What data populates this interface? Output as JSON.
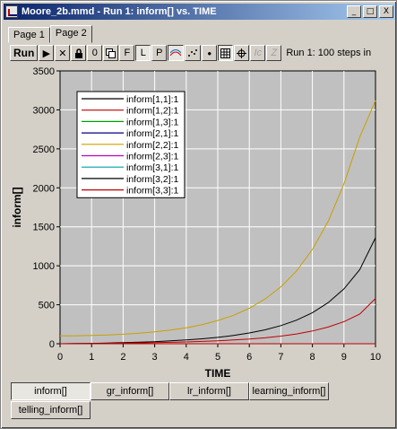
{
  "window": {
    "title": "Moore_2b.mmd - Run 1: inform[] vs. TIME",
    "minimize": "_",
    "maximize": "□",
    "close": "X"
  },
  "page_tabs": [
    "Page 1",
    "Page 2"
  ],
  "active_page_tab": 1,
  "toolbar": {
    "run_label": "Run",
    "buttons": [
      {
        "id": "play",
        "label": "▶"
      },
      {
        "id": "stop",
        "label": "✕"
      },
      {
        "id": "lock",
        "label": "🔒"
      },
      {
        "id": "zero",
        "label": "0"
      },
      {
        "id": "copy",
        "label": "⧉"
      },
      {
        "id": "f",
        "label": "F"
      },
      {
        "id": "l",
        "label": "L"
      },
      {
        "id": "p",
        "label": "P"
      },
      {
        "id": "wave",
        "label": "≈"
      },
      {
        "id": "scatter",
        "label": "⁘"
      },
      {
        "id": "dot",
        "label": "●"
      },
      {
        "id": "grid",
        "label": "▦"
      },
      {
        "id": "crosshair",
        "label": "⊕"
      },
      {
        "id": "ic",
        "label": "Ic"
      },
      {
        "id": "z",
        "label": "Z"
      }
    ],
    "run_info": "Run 1: 100 steps in"
  },
  "chart_data": {
    "type": "line",
    "xlabel": "TIME",
    "ylabel": "inform[]",
    "xlim": [
      0,
      10
    ],
    "ylim": [
      0,
      3500
    ],
    "xticks": [
      "0",
      "1",
      "2",
      "3",
      "4",
      "5",
      "6",
      "7",
      "8",
      "9",
      "10"
    ],
    "yticks": [
      "0",
      "500",
      "1000",
      "1500",
      "2000",
      "2500",
      "3000",
      "3500"
    ],
    "grid": true,
    "legend_position": "top-left",
    "x": [
      0,
      0.5,
      1,
      1.5,
      2,
      2.5,
      3,
      3.5,
      4,
      4.5,
      5,
      5.5,
      6,
      6.5,
      7,
      7.5,
      8,
      8.5,
      9,
      9.5,
      10
    ],
    "series": [
      {
        "name": "inform[1,1]:1",
        "color": "#000000",
        "values": [
          0,
          2,
          5,
          9,
          14,
          20,
          27,
          37,
          48,
          63,
          82,
          106,
          138,
          178,
          232,
          303,
          398,
          527,
          704,
          950,
          1360
        ]
      },
      {
        "name": "inform[1,2]:1",
        "color": "#c00000",
        "values": [
          0,
          1,
          3,
          5,
          7,
          10,
          14,
          18,
          23,
          30,
          38,
          48,
          60,
          76,
          98,
          126,
          163,
          214,
          283,
          380,
          580
        ]
      },
      {
        "name": "inform[1,3]:1",
        "color": "#00a000",
        "values": [
          0,
          0,
          0,
          0,
          0,
          0,
          0,
          0,
          0,
          0,
          0,
          0,
          0,
          0,
          0,
          0,
          0,
          0,
          0,
          0,
          0
        ]
      },
      {
        "name": "inform[2,1]:1",
        "color": "#000080",
        "values": [
          0,
          0,
          0,
          0,
          0,
          0,
          0,
          0,
          0,
          0,
          0,
          0,
          0,
          0,
          0,
          0,
          0,
          0,
          0,
          0,
          0
        ]
      },
      {
        "name": "inform[2,2]:1",
        "color": "#c8a000",
        "values": [
          100,
          102,
          106,
          112,
          122,
          135,
          152,
          175,
          205,
          245,
          298,
          365,
          455,
          575,
          730,
          935,
          1210,
          1570,
          2050,
          2650,
          3120
        ]
      },
      {
        "name": "inform[2,3]:1",
        "color": "#c000c0",
        "values": [
          0,
          0,
          0,
          0,
          0,
          0,
          0,
          0,
          0,
          0,
          0,
          0,
          0,
          0,
          0,
          0,
          0,
          0,
          0,
          0,
          0
        ]
      },
      {
        "name": "inform[3,1]:1",
        "color": "#00a0a0",
        "values": [
          0,
          0,
          0,
          0,
          0,
          0,
          0,
          0,
          0,
          0,
          0,
          0,
          0,
          0,
          0,
          0,
          0,
          0,
          0,
          0,
          0
        ]
      },
      {
        "name": "inform[3,2]:1",
        "color": "#000000",
        "values": [
          0,
          0,
          0,
          0,
          0,
          0,
          0,
          0,
          0,
          0,
          0,
          0,
          0,
          0,
          0,
          0,
          0,
          0,
          0,
          0,
          0
        ]
      },
      {
        "name": "inform[3,3]:1",
        "color": "#c00000",
        "values": [
          0,
          0,
          0,
          0,
          0,
          0,
          0,
          0,
          0,
          0,
          0,
          0,
          0,
          0,
          0,
          0,
          0,
          0,
          0,
          0,
          0
        ]
      }
    ]
  },
  "bottom_tabs": [
    "inform[]",
    "gr_inform[]",
    "lr_inform[]",
    "learning_inform[]",
    "telling_inform[]"
  ],
  "active_bottom_tab": 0,
  "colors": {
    "title_start": "#0a246a",
    "title_end": "#a6caf0",
    "face": "#d4d0c8",
    "plot_bg": "#c0c0c0"
  }
}
